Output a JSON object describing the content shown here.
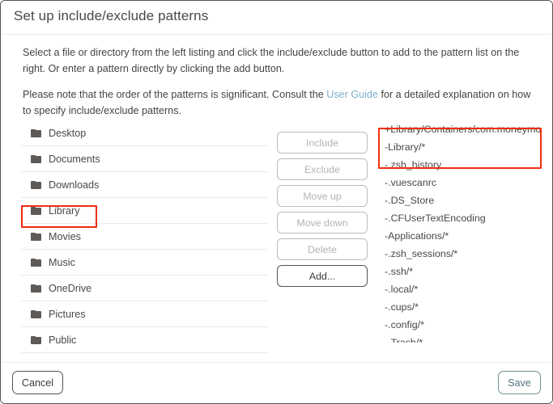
{
  "dialog": {
    "title": "Set up include/exclude patterns"
  },
  "intro": {
    "paragraph1": "Select a file or directory from the left listing and click the include/exclude button to add to the pattern list on the right. Or enter a pattern directly by clicking the add button.",
    "paragraph2_before": "Please note that the order of the patterns is significant. Consult the ",
    "link_label": "User Guide",
    "paragraph2_after": " for a detailed explanation on how to specify include/exclude patterns."
  },
  "file_list": {
    "icon": "folder-icon",
    "items": [
      {
        "label": "Desktop",
        "highlighted": false
      },
      {
        "label": "Documents",
        "highlighted": false
      },
      {
        "label": "Downloads",
        "highlighted": false
      },
      {
        "label": "Library",
        "highlighted": true
      },
      {
        "label": "Movies",
        "highlighted": false
      },
      {
        "label": "Music",
        "highlighted": false
      },
      {
        "label": "OneDrive",
        "highlighted": false
      },
      {
        "label": "Pictures",
        "highlighted": false
      },
      {
        "label": "Public",
        "highlighted": false
      }
    ]
  },
  "buttons": {
    "include": "Include",
    "exclude": "Exclude",
    "move_up": "Move up",
    "move_down": "Move down",
    "delete": "Delete",
    "add": "Add..."
  },
  "pattern_list": {
    "items": [
      "+Library/Containers/com.moneymone",
      "-Library/*",
      "-.zsh_history",
      "-.vuescanrc",
      "-.DS_Store",
      "-.CFUserTextEncoding",
      "-Applications/*",
      "-.zsh_sessions/*",
      "-.ssh/*",
      "-.local/*",
      "-.cups/*",
      "-.config/*",
      "-.Trash/*"
    ]
  },
  "footer": {
    "cancel": "Cancel",
    "save": "Save"
  },
  "colors": {
    "highlight": "#f02d11",
    "link": "#7eb0d0",
    "save_accent": "#52757d",
    "text": "#4b4845"
  }
}
